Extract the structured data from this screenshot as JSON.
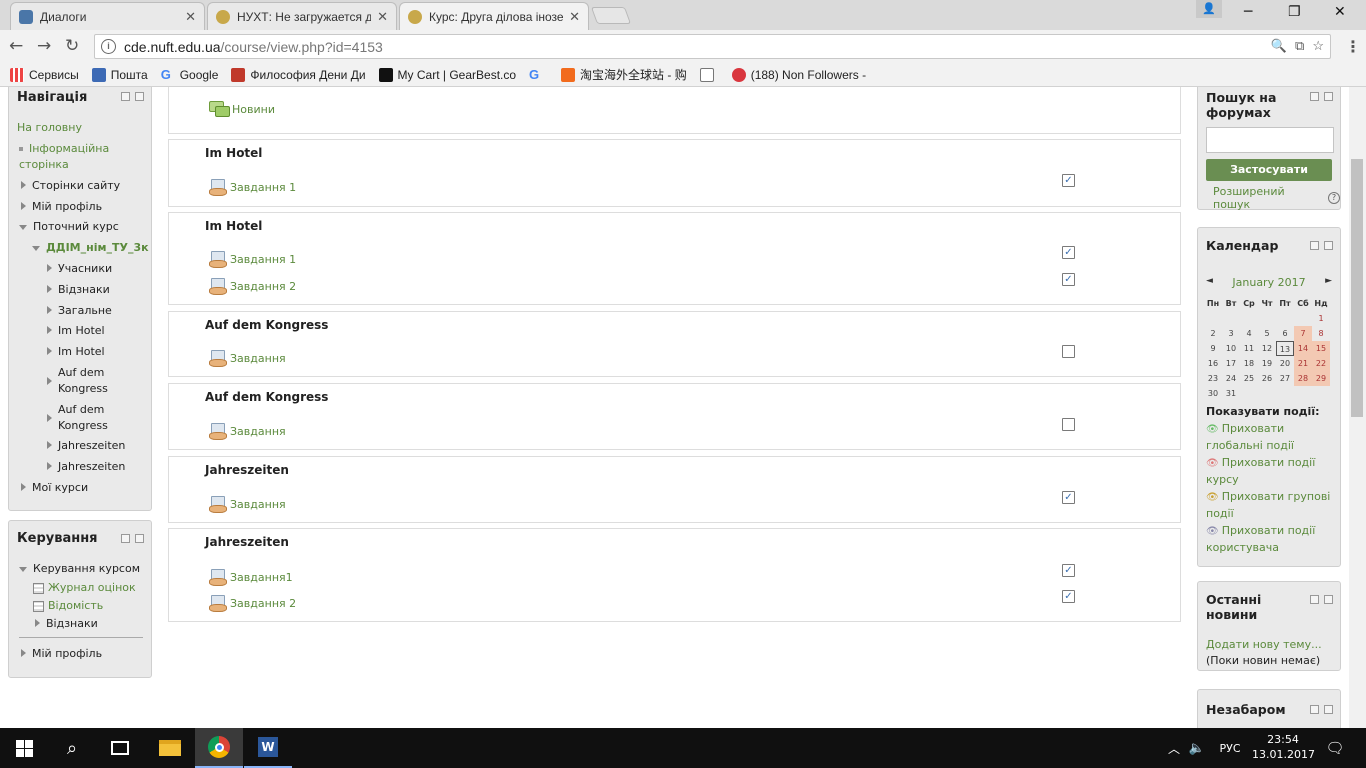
{
  "tabs": [
    {
      "label": "Диалоги",
      "close": "✕"
    },
    {
      "label": "НУХТ: Не загружается д",
      "close": "✕"
    },
    {
      "label": "Курс: Друга ділова інозе",
      "close": "✕"
    }
  ],
  "address": {
    "host": "cde.nuft.edu.ua",
    "path": "/course/view.php?id=4153"
  },
  "bookmarks": [
    "Сервисы",
    "Пошта",
    "Google",
    "Философия Дени Ди",
    "My Cart | GearBest.co",
    "",
    "淘宝海外全球站 - 购",
    "",
    "(188) Non Followers -"
  ],
  "nav": {
    "title": "Навігація",
    "home": "На головну",
    "info": "Інформаційна сторінка",
    "site_pages": "Сторінки сайту",
    "my_profile": "Мій профіль",
    "current_course": "Поточний курс",
    "course_code": "ДДІМ_нім_ТУ_3к",
    "participants": "Учасники",
    "badges": "Відзнаки",
    "general": "Загальне",
    "s1": "Im Hotel",
    "s2": "Im Hotel",
    "s3": "Auf dem Kongress",
    "s4": "Auf dem Kongress",
    "s5": "Jahreszeiten",
    "s6": "Jahreszeiten",
    "my_courses": "Мої курси"
  },
  "admin": {
    "title": "Керування",
    "course_admin": "Керування курсом",
    "gradebook": "Журнал оцінок",
    "grades": "Відомість",
    "badges": "Відзнаки",
    "my_profile": "Мій профіль"
  },
  "sections": {
    "news": "Новини",
    "s1": {
      "title": "Im Hotel",
      "a1": "Завдання 1"
    },
    "s2": {
      "title": "Im Hotel",
      "a1": "Завдання 1",
      "a2": "Завдання 2"
    },
    "s3": {
      "title": "Auf dem Kongress",
      "a1": "Завдання"
    },
    "s4": {
      "title": "Auf dem Kongress",
      "a1": "Завдання"
    },
    "s5": {
      "title": "Jahreszeiten",
      "a1": "Завдання"
    },
    "s6": {
      "title": "Jahreszeiten",
      "a1": "Завдання1",
      "a2": "Завдання 2"
    }
  },
  "completion": {
    "s1a1": true,
    "s2a1": true,
    "s2a2": true,
    "s3a1": false,
    "s4a1": false,
    "s5a1": true,
    "s6a1": true,
    "s6a2": true
  },
  "forum_search": {
    "title": "Пошук на форумах",
    "button": "Застосувати",
    "advanced": "Розширений пошук"
  },
  "calendar": {
    "title": "Календар",
    "month": "January 2017",
    "prev": "◄",
    "next": "►",
    "days": [
      "Пн",
      "Вт",
      "Ср",
      "Чт",
      "Пт",
      "Сб",
      "Нд"
    ],
    "show_events": "Показувати події:",
    "hide_global": "Приховати глобальні події",
    "hide_course": "Приховати події курсу",
    "hide_group": "Приховати групові події",
    "hide_user": "Приховати події користувача"
  },
  "news": {
    "title": "Останні новини",
    "add": "Додати нову тему...",
    "none": "(Поки новин немає)"
  },
  "upcoming": {
    "title": "Незабаром"
  },
  "taskbar": {
    "lang": "РУС",
    "time": "23:54",
    "date": "13.01.2017"
  },
  "colors": {
    "link": "#5b8a3c",
    "button": "#6a8e52",
    "weekend": "#f3c9b3"
  }
}
